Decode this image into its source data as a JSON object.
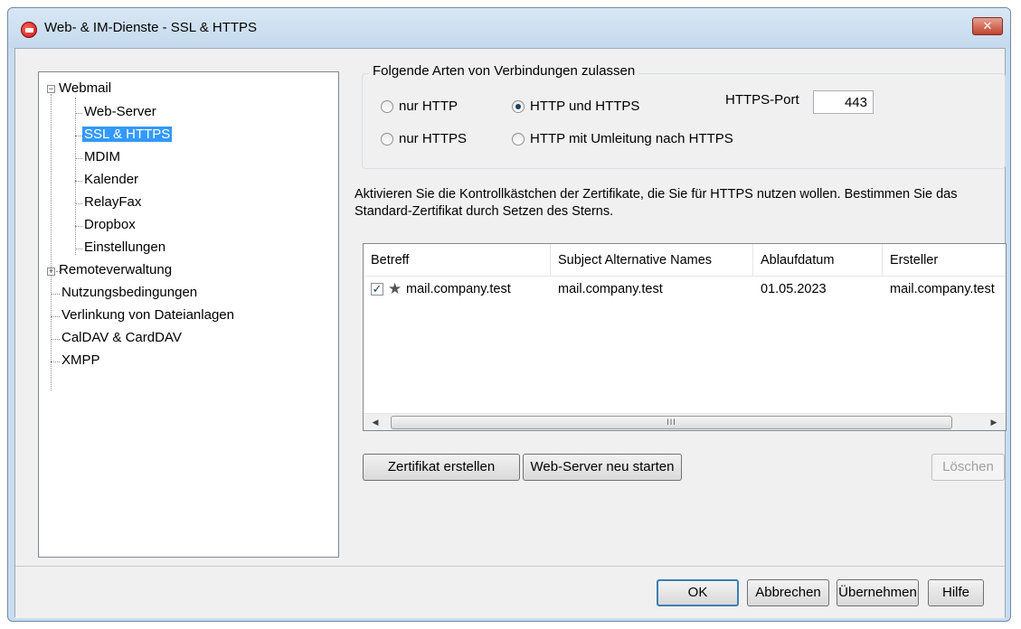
{
  "window": {
    "title": "Web- & IM-Dienste - SSL & HTTPS",
    "close_label": "✕"
  },
  "tree": {
    "webmail": {
      "label": "Webmail",
      "children": [
        "Web-Server",
        "SSL & HTTPS",
        "MDIM",
        "Kalender",
        "RelayFax",
        "Dropbox",
        "Einstellungen"
      ]
    },
    "items": [
      "Remoteverwaltung",
      "Nutzungsbedingungen",
      "Verlinkung von Dateianlagen",
      "CalDAV & CardDAV",
      "XMPP"
    ],
    "selected": "SSL & HTTPS"
  },
  "connections": {
    "legend": "Folgende Arten von Verbindungen zulassen",
    "options": [
      "nur HTTP",
      "HTTP und HTTPS",
      "nur HTTPS",
      "HTTP mit Umleitung nach HTTPS"
    ],
    "selected": "HTTP und HTTPS",
    "port_label": "HTTPS-Port",
    "port_value": "443"
  },
  "description": "Aktivieren Sie die Kontrollkästchen der Zertifikate, die Sie für HTTPS nutzen wollen. Bestimmen Sie das Standard-Zertifikat durch Setzen des Sterns.",
  "certificates": {
    "columns": [
      "Betreff",
      "Subject Alternative Names",
      "Ablaufdatum",
      "Ersteller"
    ],
    "rows": [
      {
        "checked": true,
        "starred": true,
        "subject": "mail.company.test",
        "san": "mail.company.test",
        "expires": "01.05.2023",
        "issuer": "mail.company.test"
      }
    ],
    "scroll_grip": "III"
  },
  "actions": {
    "create": "Zertifikat erstellen",
    "restart": "Web-Server neu starten",
    "delete": "Löschen"
  },
  "footer": {
    "ok": "OK",
    "cancel": "Abbrechen",
    "apply": "Übernehmen",
    "help": "Hilfe"
  }
}
